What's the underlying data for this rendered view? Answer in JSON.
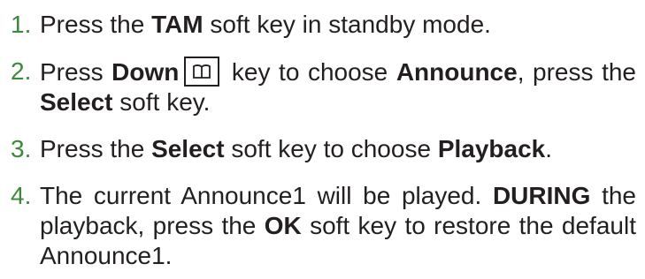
{
  "colors": {
    "number": "#3a8a3a",
    "text": "#231f20"
  },
  "steps": [
    {
      "number": "1.",
      "parts": [
        {
          "text": "Press the ",
          "bold": false
        },
        {
          "text": "TAM",
          "bold": true
        },
        {
          "text": " soft key in standby mode.",
          "bold": false
        }
      ]
    },
    {
      "number": "2.",
      "parts": [
        {
          "text": "Press ",
          "bold": false
        },
        {
          "text": "Down",
          "bold": true
        },
        {
          "icon": "phonebook-icon"
        },
        {
          "text": " key to choose ",
          "bold": false
        },
        {
          "text": "Announce",
          "bold": true
        },
        {
          "text": ", press the ",
          "bold": false
        },
        {
          "text": "Select",
          "bold": true
        },
        {
          "text": " soft key.",
          "bold": false
        }
      ]
    },
    {
      "number": "3.",
      "parts": [
        {
          "text": "Press the ",
          "bold": false
        },
        {
          "text": "Select",
          "bold": true
        },
        {
          "text": " soft key to choose ",
          "bold": false
        },
        {
          "text": "Playback",
          "bold": true
        },
        {
          "text": ".",
          "bold": false
        }
      ]
    },
    {
      "number": "4.",
      "parts": [
        {
          "text": "The current Announce1 will be played. ",
          "bold": false
        },
        {
          "text": "DURING",
          "bold": true
        },
        {
          "text": " the playback, press the ",
          "bold": false
        },
        {
          "text": "OK",
          "bold": true
        },
        {
          "text": " soft key to restore the default Announce1.",
          "bold": false
        }
      ]
    }
  ]
}
